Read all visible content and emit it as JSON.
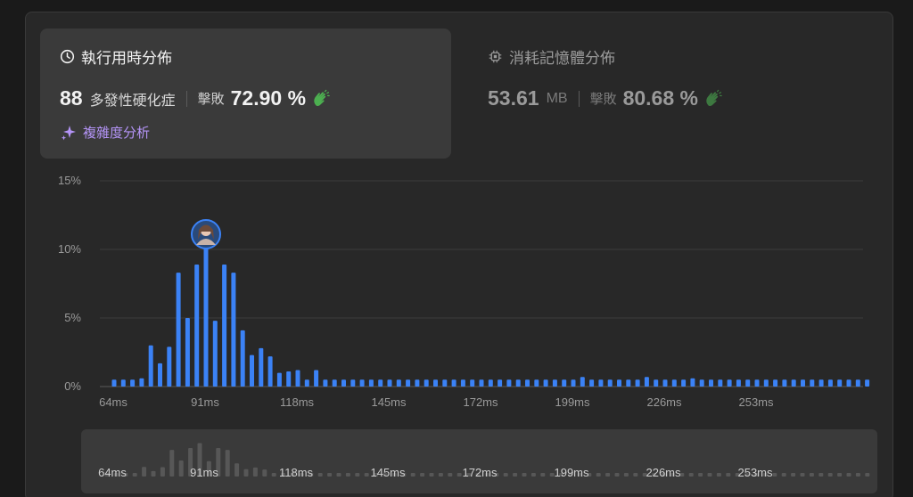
{
  "runtime": {
    "title": "執行用時分佈",
    "value": "88",
    "complexity": "多發性硬化症",
    "beats_label": "擊敗",
    "beats_pct": "72.90 %",
    "analysis_label": "複雜度分析"
  },
  "memory": {
    "title": "消耗記憶體分佈",
    "value": "53.61",
    "unit": "MB",
    "beats_label": "擊敗",
    "beats_pct": "80.68 %"
  },
  "colors": {
    "bar": "#3b82f6",
    "accent_purple": "#b494f7",
    "clap_green": "#4caf50"
  },
  "chart_data": {
    "type": "bar",
    "ylim": [
      0,
      15
    ],
    "y_ticks": [
      "0%",
      "5%",
      "10%",
      "15%"
    ],
    "y_tick_values": [
      0,
      5,
      10,
      15
    ],
    "x_tick_labels": [
      "64ms",
      "91ms",
      "118ms",
      "145ms",
      "172ms",
      "199ms",
      "226ms",
      "253ms"
    ],
    "x_tick_bar_index": [
      0,
      10,
      20,
      30,
      40,
      50,
      60,
      70
    ],
    "highlight_bar_index": 10,
    "values": [
      0.5,
      0.5,
      0.5,
      0.6,
      3.0,
      1.7,
      2.9,
      8.3,
      5.0,
      8.9,
      10.4,
      4.8,
      8.9,
      8.3,
      4.1,
      2.3,
      2.8,
      2.2,
      1.0,
      1.1,
      1.2,
      0.5,
      1.2,
      0.5,
      0.5,
      0.5,
      0.5,
      0.5,
      0.5,
      0.5,
      0.5,
      0.5,
      0.5,
      0.5,
      0.5,
      0.5,
      0.5,
      0.5,
      0.5,
      0.5,
      0.5,
      0.5,
      0.5,
      0.5,
      0.5,
      0.5,
      0.5,
      0.5,
      0.5,
      0.5,
      0.5,
      0.7,
      0.5,
      0.5,
      0.5,
      0.5,
      0.5,
      0.5,
      0.7,
      0.5,
      0.5,
      0.5,
      0.5,
      0.6,
      0.5,
      0.5,
      0.5,
      0.5,
      0.5,
      0.5,
      0.5,
      0.5,
      0.5,
      0.5,
      0.5,
      0.5,
      0.5,
      0.5,
      0.5,
      0.5,
      0.5,
      0.5,
      0.5
    ]
  }
}
